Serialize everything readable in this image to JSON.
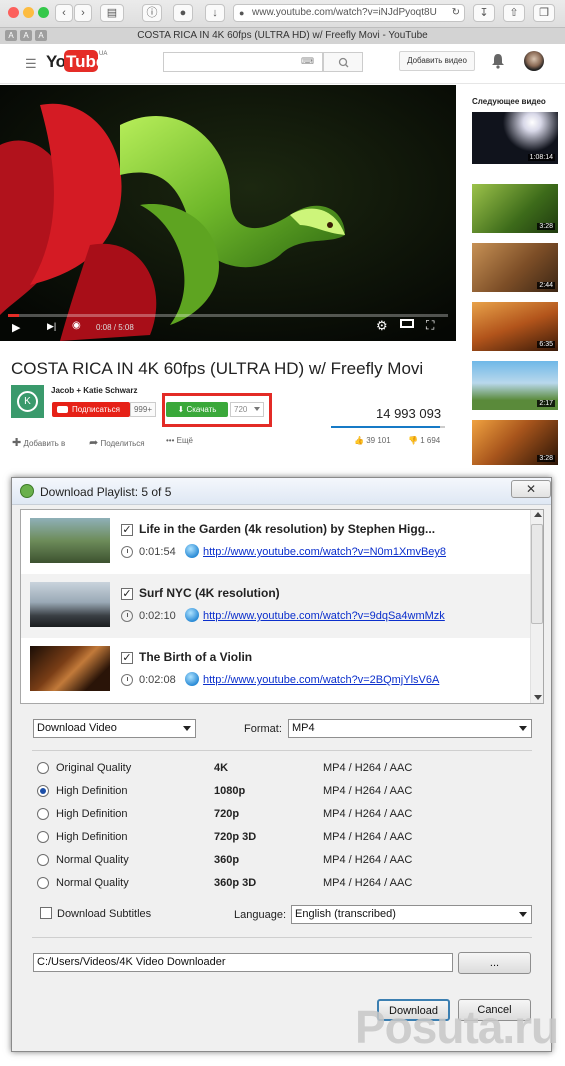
{
  "browser": {
    "url": "www.youtube.com/watch?v=iNJdPyoqt8U",
    "tab_title": "COSTA RICA IN 4K 60fps (ULTRA HD) w/ Freefly Movi - YouTube",
    "reader_buttons": [
      "A",
      "A",
      "A"
    ]
  },
  "youtube": {
    "logo_you": "You",
    "logo_tube": "Tube",
    "logo_region": "UA",
    "add_video_label": "Добавить видео",
    "player": {
      "time": "0:08 / 5:08",
      "progress_fraction": 0.026
    },
    "video_title": "COSTA RICA IN 4K 60fps (ULTRA HD) w/ Freefly Movi",
    "channel_name": "Jacob + Katie Schwarz",
    "subscribe_label": "Подписаться",
    "subscriber_count": "999+",
    "download_label": "Скачать",
    "download_quality": "720",
    "view_count": "14 993 093",
    "actions": {
      "add_to": "Добавить в",
      "share": "Поделиться",
      "more": "Ещё",
      "likes": "39 101",
      "dislikes": "1 694",
      "like_fraction": 0.958
    },
    "sidebar": {
      "next_label": "Следующее видео",
      "durations": [
        "1:08:14",
        "3:28",
        "2:44",
        "6:35",
        "2:17",
        "3:28"
      ]
    }
  },
  "dialog": {
    "title": "Download Playlist: 5 of 5",
    "close_label": "✕",
    "items": [
      {
        "title": "Life in the Garden (4k resolution) by Stephen Higg...",
        "duration": "0:01:54",
        "url": "http://www.youtube.com/watch?v=N0m1XmvBey8",
        "checked": true
      },
      {
        "title": "Surf NYC (4K resolution)",
        "duration": "0:02:10",
        "url": "http://www.youtube.com/watch?v=9dqSa4wmMzk",
        "checked": true
      },
      {
        "title": "The Birth of a Violin",
        "duration": "0:02:08",
        "url": "http://www.youtube.com/watch?v=2BQmjYlsV6A",
        "checked": true
      }
    ],
    "mode_select": "Download Video",
    "format_label": "Format:",
    "format_value": "MP4",
    "qualities": [
      {
        "name": "Original Quality",
        "res": "4K",
        "codec": "MP4 / H264 / AAC",
        "selected": false
      },
      {
        "name": "High Definition",
        "res": "1080p",
        "codec": "MP4 / H264 / AAC",
        "selected": true
      },
      {
        "name": "High Definition",
        "res": "720p",
        "codec": "MP4 / H264 / AAC",
        "selected": false
      },
      {
        "name": "High Definition",
        "res": "720p 3D",
        "codec": "MP4 / H264 / AAC",
        "selected": false
      },
      {
        "name": "Normal Quality",
        "res": "360p",
        "codec": "MP4 / H264 / AAC",
        "selected": false
      },
      {
        "name": "Normal Quality",
        "res": "360p 3D",
        "codec": "MP4 / H264 / AAC",
        "selected": false
      }
    ],
    "subtitles_label": "Download Subtitles",
    "language_label": "Language:",
    "language_value": "English (transcribed)",
    "path": "C:/Users/Videos/4K Video Downloader",
    "browse_label": "...",
    "download_label": "Download",
    "cancel_label": "Cancel"
  },
  "watermark": "Posuta.ru",
  "colors": {
    "youtube_red": "#e52d27",
    "download_green": "#3aa83a",
    "highlight_box": "#e32b26",
    "link_blue": "#0b2fcc"
  }
}
